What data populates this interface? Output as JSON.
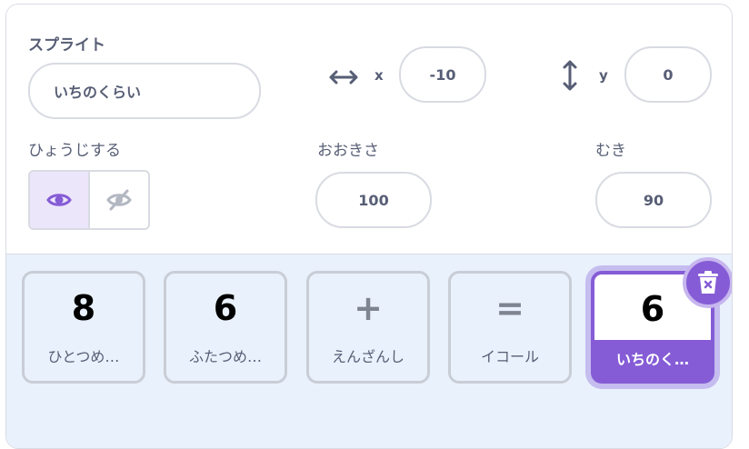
{
  "sprite": {
    "label": "スプライト",
    "name_value": "いちのくらい",
    "x_letter": "x",
    "x_value": "-10",
    "y_letter": "y",
    "y_value": "0",
    "show_label": "ひょうじする",
    "size_label": "おおきさ",
    "size_value": "100",
    "direction_label": "むき",
    "direction_value": "90",
    "visible": true
  },
  "tiles": [
    {
      "value": "8",
      "caption": "ひとつめ…",
      "selected": false
    },
    {
      "value": "6",
      "caption": "ふたつめ…",
      "selected": false
    },
    {
      "value": "+",
      "caption": "えんざんし",
      "selected": false
    },
    {
      "value": "=",
      "caption": "イコール",
      "selected": false
    },
    {
      "value": "6",
      "caption": "いちのく…",
      "selected": true
    }
  ],
  "colors": {
    "accent": "#855cd6",
    "accent_light": "#ece6fa",
    "tray_bg": "#e9f1fc",
    "text": "#575e75",
    "border": "#d9dbe3"
  },
  "icons": {
    "x_axis": "horizontal-arrows-icon",
    "y_axis": "vertical-arrows-icon",
    "show": "eye-icon",
    "hide": "eye-slash-icon",
    "delete": "trash-icon"
  }
}
